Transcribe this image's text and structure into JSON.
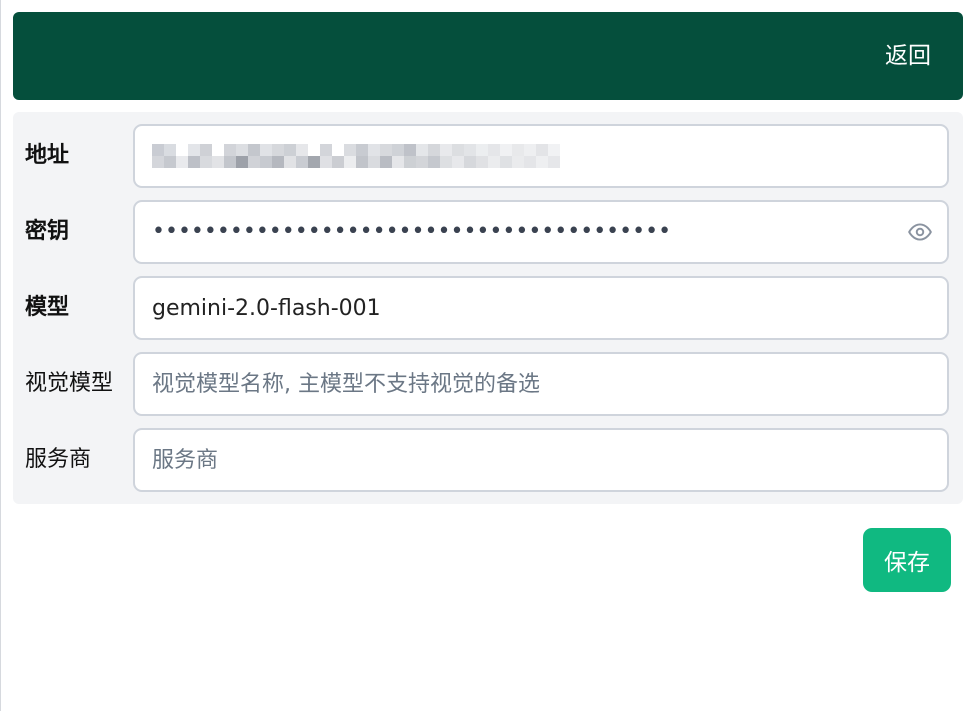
{
  "header": {
    "back_label": "返回",
    "background": "#054f3c"
  },
  "form": {
    "address": {
      "label": "地址",
      "icon": "pixelated-redacted-value"
    },
    "key": {
      "label": "密钥",
      "masked_value": "••••••••••••••••••••••••••••••••••••••••",
      "icon": "eye-icon"
    },
    "model": {
      "label": "模型",
      "value": "gemini-2.0-flash-001"
    },
    "vision_model": {
      "label": "视觉模型",
      "placeholder": "视觉模型名称, 主模型不支持视觉的备选"
    },
    "provider": {
      "label": "服务商",
      "placeholder": "服务商"
    }
  },
  "actions": {
    "save_label": "保存",
    "save_color": "#10b981"
  }
}
